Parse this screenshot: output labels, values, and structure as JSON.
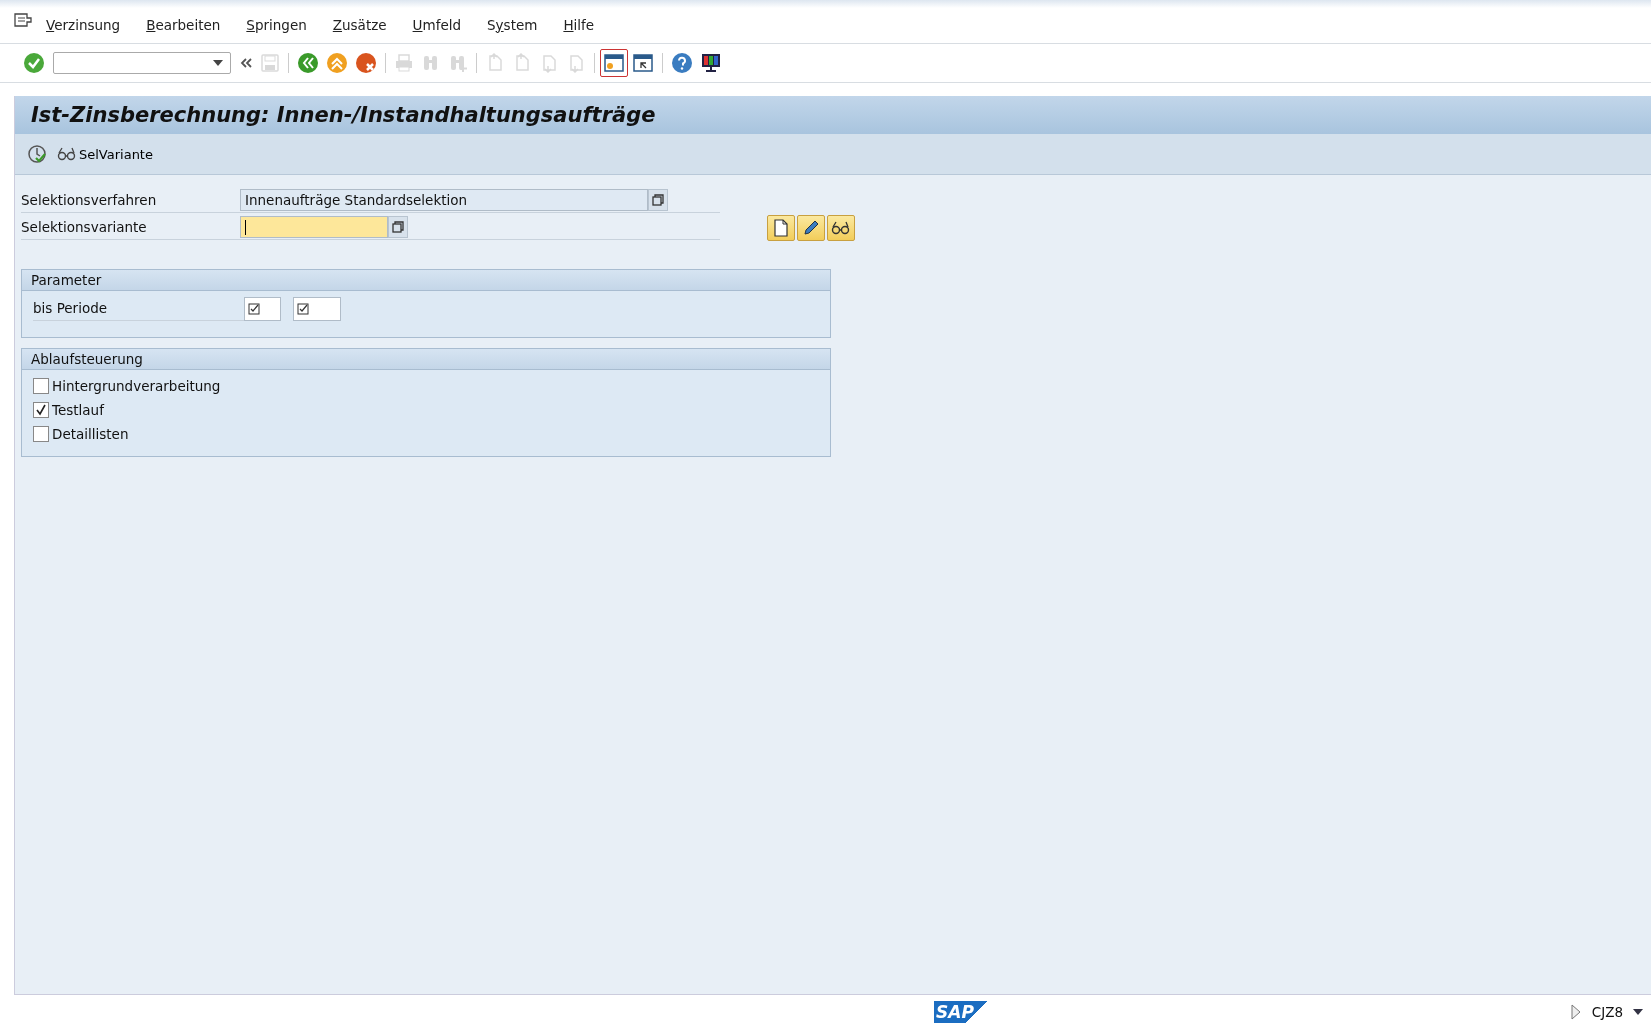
{
  "menu": [
    {
      "key": "V",
      "after": "erzinsung"
    },
    {
      "key": "B",
      "after": "earbeiten"
    },
    {
      "key": "S",
      "after": "pringen"
    },
    {
      "key": "Z",
      "after": "usätze"
    },
    {
      "key": "U",
      "after": "mfeld"
    },
    {
      "before": "S",
      "key": "y",
      "after": "stem"
    },
    {
      "key": "H",
      "after": "ilfe"
    }
  ],
  "toolbar": [
    {
      "kind": "enter",
      "disabled": false
    },
    {
      "kind": "command"
    },
    {
      "kind": "collapse",
      "disabled": false
    },
    {
      "kind": "save",
      "disabled": true
    },
    {
      "kind": "sep"
    },
    {
      "kind": "back",
      "disabled": false
    },
    {
      "kind": "exit",
      "disabled": false
    },
    {
      "kind": "cancel",
      "disabled": false
    },
    {
      "kind": "sep"
    },
    {
      "kind": "print",
      "disabled": true
    },
    {
      "kind": "find",
      "disabled": true
    },
    {
      "kind": "findnext",
      "disabled": true
    },
    {
      "kind": "sep"
    },
    {
      "kind": "first",
      "disabled": true
    },
    {
      "kind": "prev",
      "disabled": true
    },
    {
      "kind": "next",
      "disabled": true
    },
    {
      "kind": "last",
      "disabled": true
    },
    {
      "kind": "sep"
    },
    {
      "kind": "session",
      "disabled": false,
      "selected": true
    },
    {
      "kind": "shortcut",
      "disabled": false,
      "selected": false
    },
    {
      "kind": "sep"
    },
    {
      "kind": "help",
      "disabled": false
    },
    {
      "kind": "layout",
      "disabled": false
    }
  ],
  "title": "Ist-Zinsberechnung: Innen-/Instandhaltungsaufträge",
  "app_toolbar": {
    "execute": true,
    "variant_label": "SelVariante"
  },
  "fields": [
    {
      "label": "Selektionsverfahren",
      "value": "Innenaufträge Standardselektion",
      "focused": false
    },
    {
      "label": "Selektionsvariante",
      "focused": true
    }
  ],
  "parameter_group": {
    "title": "Parameter",
    "label": "bis Periode"
  },
  "control_group": {
    "title": "Ablaufsteuerung",
    "options": [
      {
        "label": "Hintergrundverarbeitung",
        "checked": false
      },
      {
        "label": "Testlauf",
        "checked": true
      },
      {
        "label": "Detaillisten",
        "checked": false
      }
    ]
  },
  "status_bar": {
    "logo": "SAP",
    "transaction": "CJZ8"
  }
}
